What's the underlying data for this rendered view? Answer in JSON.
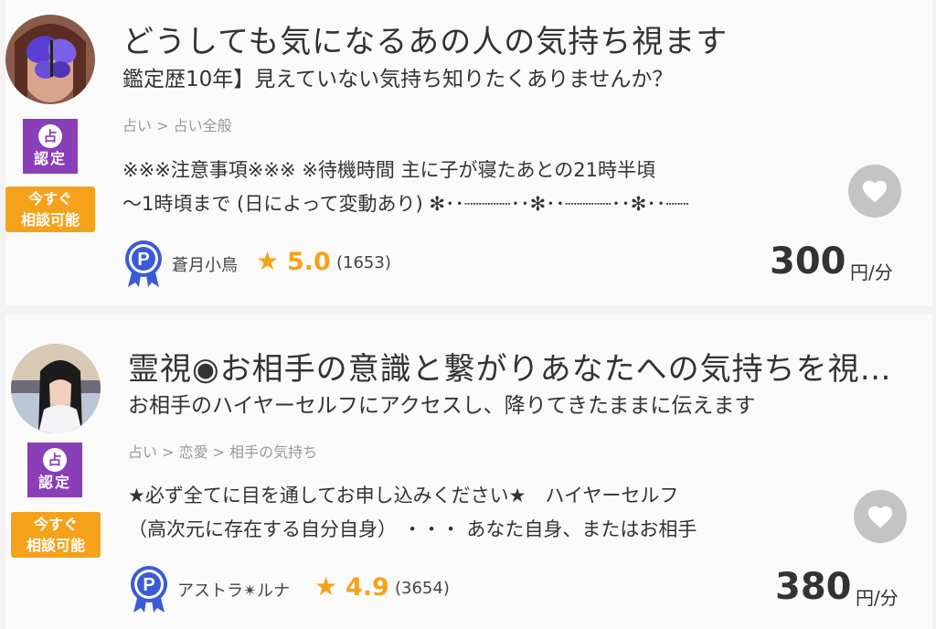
{
  "cards": [
    {
      "title": "どうしても気になるあの人の気持ち視ます",
      "subtitle": "鑑定歴10年】見えていない気持ち知りたくありませんか？",
      "breadcrumbs": "占い > 占い全般",
      "cert_top": "占",
      "cert_bottom": "認定",
      "now_line1": "今すぐ",
      "now_line2": "相談可能",
      "desc_line1": "※※※注意事項※※※ ※待機時間 主に子が寝たあとの21時半頃",
      "desc_line2": "〜1時頃まで (日によって変動あり)  ✻･･┈┈┈┈･･✻･･┈┈┈┈･･✻･･┈┈",
      "name": "蒼月小鳥",
      "star": "★",
      "rating": "5.0",
      "reviews": "(1653)",
      "price": "300",
      "unit": "円/分",
      "favorite_icon": "heart-icon"
    },
    {
      "title": "霊視◉お相手の意識と繋がりあなたへの気持ちを視…",
      "subtitle": "お相手のハイヤーセルフにアクセスし、降りてきたままに伝えます",
      "breadcrumbs": "占い > 恋愛 > 相手の気持ち",
      "cert_top": "占",
      "cert_bottom": "認定",
      "now_line1": "今すぐ",
      "now_line2": "相談可能",
      "desc_line1": "★必ず全てに目を通してお申し込みください★　ハイヤーセルフ",
      "desc_line2": "（高次元に存在する自分自身）  ・・・  あなた自身、またはお相手",
      "name": "アストラ✴ルナ",
      "star": "★",
      "rating": "4.9",
      "reviews": "(3654)",
      "price": "380",
      "unit": "円/分",
      "favorite_icon": "heart-icon"
    }
  ],
  "colors": {
    "accent_orange": "#f5a21b",
    "cert_purple": "#8a3eb8",
    "heart_gray": "#c4c4c4",
    "badge_blue": "#3b5bd6"
  }
}
